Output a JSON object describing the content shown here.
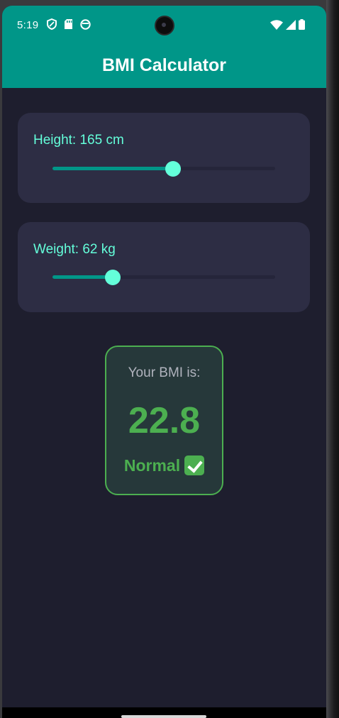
{
  "status_bar": {
    "time": "5:19",
    "left_icons": [
      "vpn-shield-icon",
      "sd-card-icon",
      "notification-app-icon"
    ],
    "right_icons": [
      "wifi-icon",
      "cell-signal-icon",
      "battery-icon"
    ]
  },
  "app_bar": {
    "title": "BMI Calculator",
    "color": "#009688"
  },
  "height_card": {
    "label": "Height: 165 cm",
    "slider_fraction": 0.54
  },
  "weight_card": {
    "label": "Weight: 62 kg",
    "slider_fraction": 0.27
  },
  "result": {
    "label": "Your BMI is:",
    "value": "22.8",
    "category": "Normal",
    "category_icon": "check-mark-icon",
    "color": "#4caf50"
  },
  "colors": {
    "background": "#1e1e2e",
    "card": "#2d2d44",
    "accent": "#64ffda",
    "primary": "#009688"
  }
}
